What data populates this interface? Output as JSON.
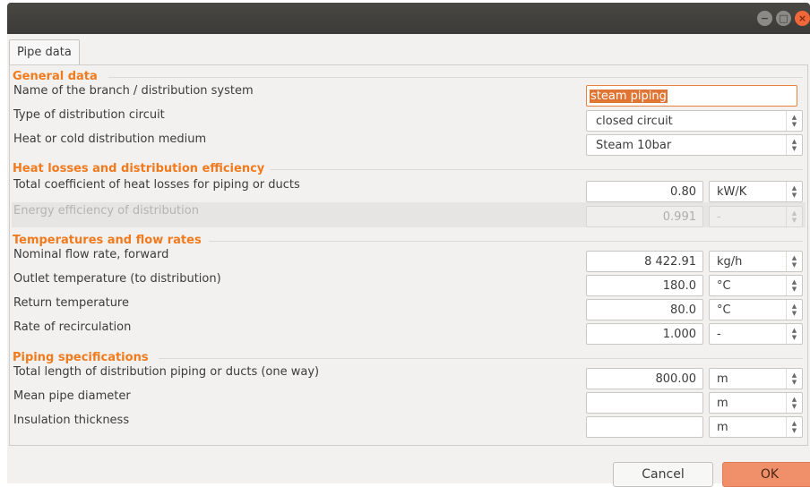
{
  "window": {
    "buttons": {
      "minimize": "−",
      "maximize": "□",
      "close": "×"
    }
  },
  "tab": {
    "label": "Pipe data"
  },
  "sections": {
    "general": "General data",
    "heat": "Heat losses and distribution efficiency",
    "temps": "Temperatures and flow rates",
    "piping": "Piping specifications"
  },
  "fields": {
    "name": {
      "label": "Name of the branch / distribution system",
      "value": "steam piping"
    },
    "circuit": {
      "label": "Type of distribution circuit",
      "value": "closed circuit"
    },
    "medium": {
      "label": "Heat or cold distribution medium",
      "value": "Steam  10bar"
    },
    "heatloss": {
      "label": "Total coefficient of heat losses for piping or ducts",
      "value": "0.80",
      "unit": "kW/K"
    },
    "efficiency": {
      "label": "Energy efficiency of distribution",
      "value": "0.991",
      "unit": "-"
    },
    "flow": {
      "label": "Nominal flow rate, forward",
      "value": "8 422.91",
      "unit": "kg/h"
    },
    "outlet": {
      "label": "Outlet temperature (to distribution)",
      "value": "180.0",
      "unit": "°C"
    },
    "return": {
      "label": "Return temperature",
      "value": "80.0",
      "unit": "°C"
    },
    "recirc": {
      "label": "Rate of recirculation",
      "value": "1.000",
      "unit": "-"
    },
    "length": {
      "label": "Total length of distribution piping or ducts (one way)",
      "value": "800.00",
      "unit": "m"
    },
    "diameter": {
      "label": "Mean pipe diameter",
      "value": "",
      "unit": "m"
    },
    "insulation": {
      "label": "Insulation thickness",
      "value": "",
      "unit": "m"
    }
  },
  "spin_glyph": "▲\n▼",
  "buttons": {
    "cancel": "Cancel",
    "ok": "OK"
  },
  "colors": {
    "accent": "#f07b1e",
    "ok_button": "#f0906a",
    "titlebar": "#3b3a36"
  }
}
